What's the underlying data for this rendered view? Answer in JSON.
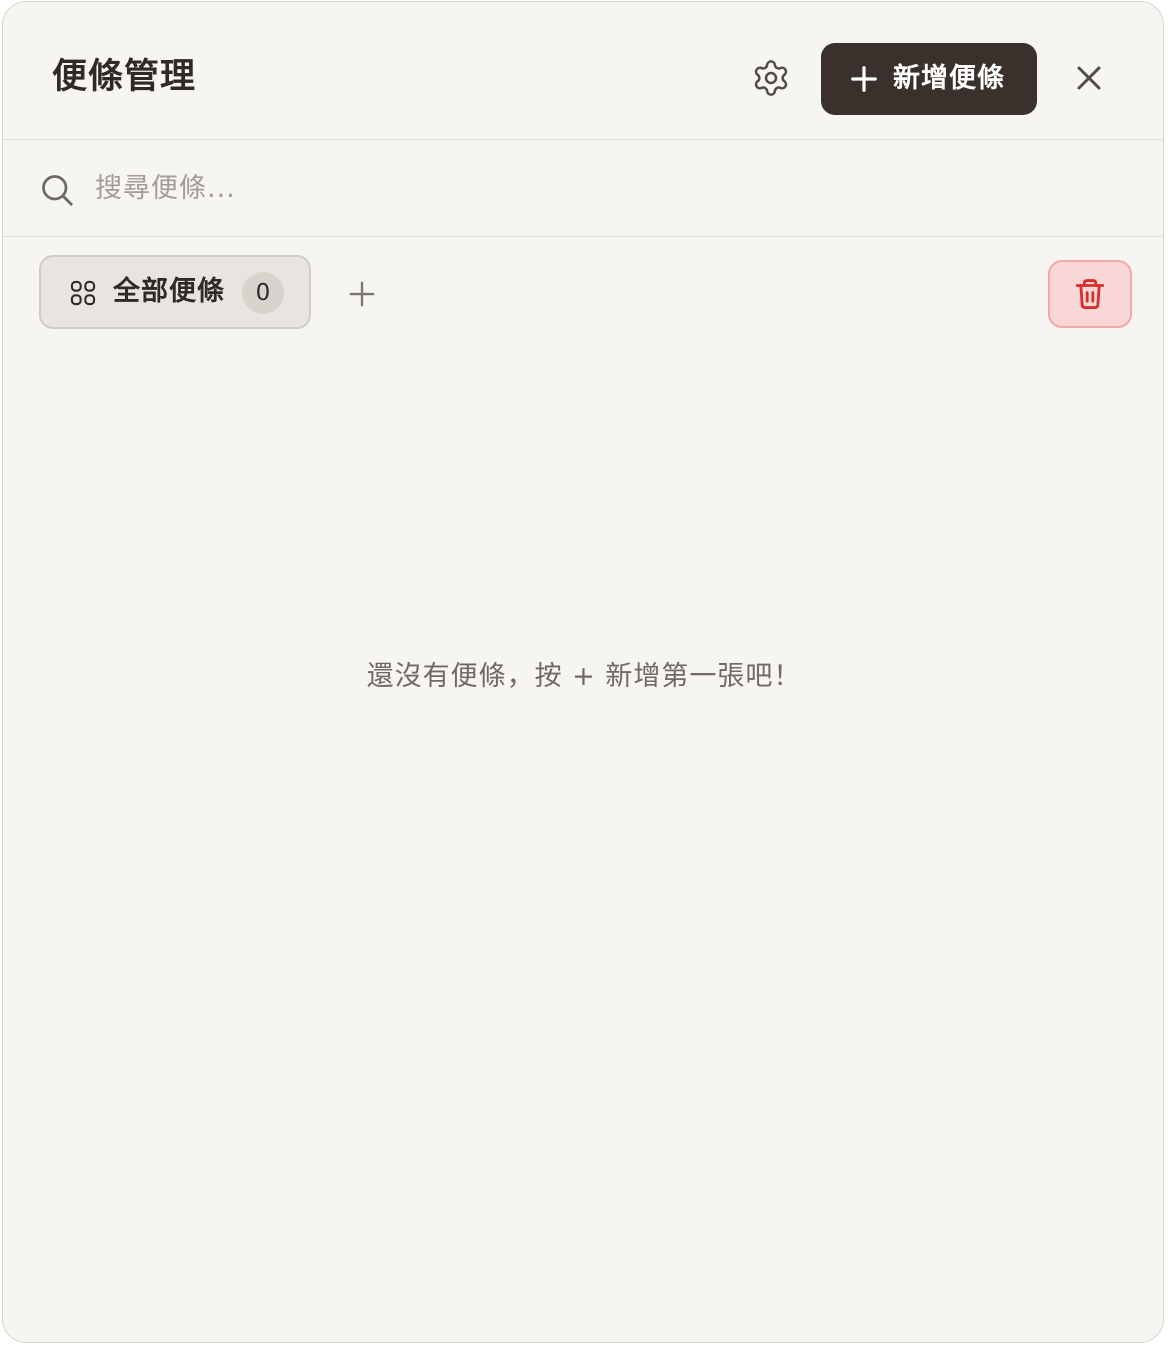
{
  "header": {
    "title": "便條管理",
    "add_note_label": "新增便條"
  },
  "search": {
    "placeholder": "搜尋便條..."
  },
  "categories": [
    {
      "label": "全部便條",
      "count": "0",
      "icon": "grid-icon",
      "selected": true
    }
  ],
  "empty_state": {
    "message": "還沒有便條，按 + 新增第一張吧！"
  },
  "icons": {
    "settings": "gear-icon",
    "add": "plus-icon",
    "close": "close-icon",
    "search": "search-icon",
    "category": "grid-icon",
    "add_category": "plus-icon",
    "delete": "trash-icon"
  },
  "colors": {
    "background": "#f7f5f1",
    "primary_button": "#3a312c",
    "delete_bg": "#f8d7d6",
    "delete_icon": "#d9302c",
    "chip_bg": "#e8e5e0"
  }
}
